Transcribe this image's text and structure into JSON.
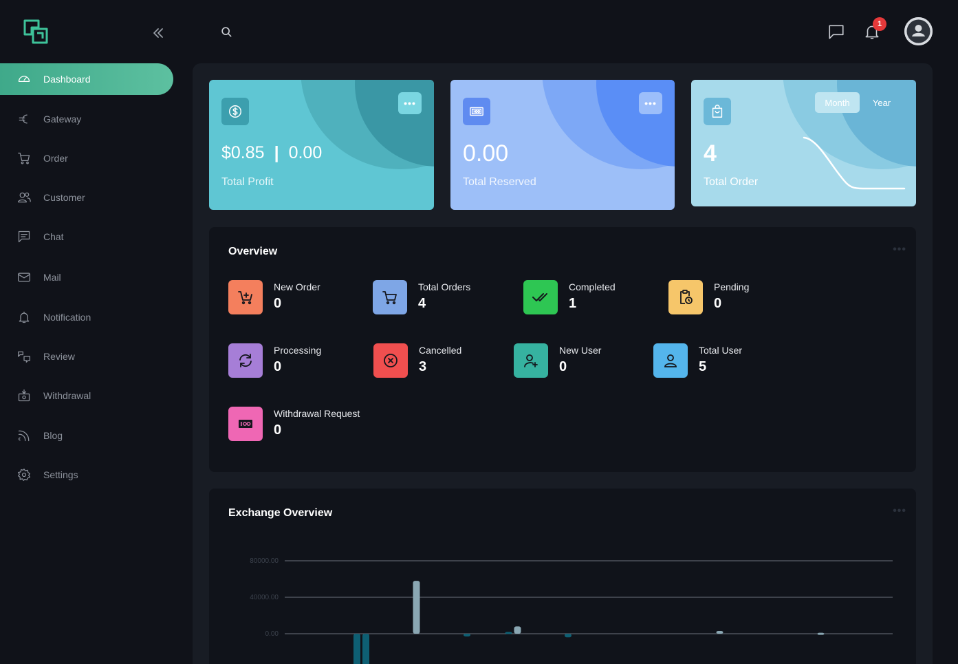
{
  "sidebar": {
    "items": [
      {
        "label": "Dashboard",
        "icon": "dashboard-icon",
        "active": true
      },
      {
        "label": "Gateway",
        "icon": "euro-icon"
      },
      {
        "label": "Order",
        "icon": "cart-icon"
      },
      {
        "label": "Customer",
        "icon": "users-icon"
      },
      {
        "label": "Chat",
        "icon": "chat-icon"
      },
      {
        "label": "Mail",
        "icon": "mail-icon"
      },
      {
        "label": "Notification",
        "icon": "bell-icon"
      },
      {
        "label": "Review",
        "icon": "review-icon"
      },
      {
        "label": "Withdrawal",
        "icon": "withdrawal-icon"
      },
      {
        "label": "Blog",
        "icon": "blog-icon"
      },
      {
        "label": "Settings",
        "icon": "gear-icon"
      }
    ]
  },
  "topbar": {
    "notification_count": "1"
  },
  "cards": {
    "profit": {
      "value_main": "$0.85",
      "separator": "|",
      "value_secondary": "0.00",
      "label": "Total Profit",
      "more": "•••"
    },
    "reserved": {
      "value": "0.00",
      "label": "Total Reserved",
      "more": "•••"
    },
    "orders": {
      "value": "4",
      "label": "Total Order",
      "tab_month": "Month",
      "tab_year": "Year"
    }
  },
  "overview": {
    "title": "Overview",
    "more": "•••",
    "stats": [
      {
        "name": "New Order",
        "value": "0",
        "color": "#f47f5d"
      },
      {
        "name": "Total Orders",
        "value": "4",
        "color": "#7ea6e6"
      },
      {
        "name": "Completed",
        "value": "1",
        "color": "#2ec653"
      },
      {
        "name": "Pending",
        "value": "0",
        "color": "#f6c66a"
      },
      {
        "name": "Processing",
        "value": "0",
        "color": "#a67ed7"
      },
      {
        "name": "Cancelled",
        "value": "3",
        "color": "#f04f4f"
      },
      {
        "name": "New User",
        "value": "0",
        "color": "#36b2a0"
      },
      {
        "name": "Total User",
        "value": "5",
        "color": "#54b5ec"
      },
      {
        "name": "Withdrawal Request",
        "value": "0",
        "color": "#ef67b4"
      }
    ]
  },
  "exchange": {
    "title": "Exchange Overview",
    "more": "•••"
  },
  "chart_data": {
    "type": "bar",
    "yticks": [
      "80000.00",
      "40000.00",
      "0.00"
    ],
    "ylim": [
      -40000,
      80000
    ],
    "series": [
      {
        "values": [
          -40000,
          0,
          0,
          2000,
          0,
          0,
          0,
          0,
          0,
          0
        ]
      },
      {
        "values": [
          -40000,
          58000,
          -3000,
          8000,
          -4000,
          0,
          0,
          3000,
          0,
          1000
        ]
      }
    ]
  }
}
